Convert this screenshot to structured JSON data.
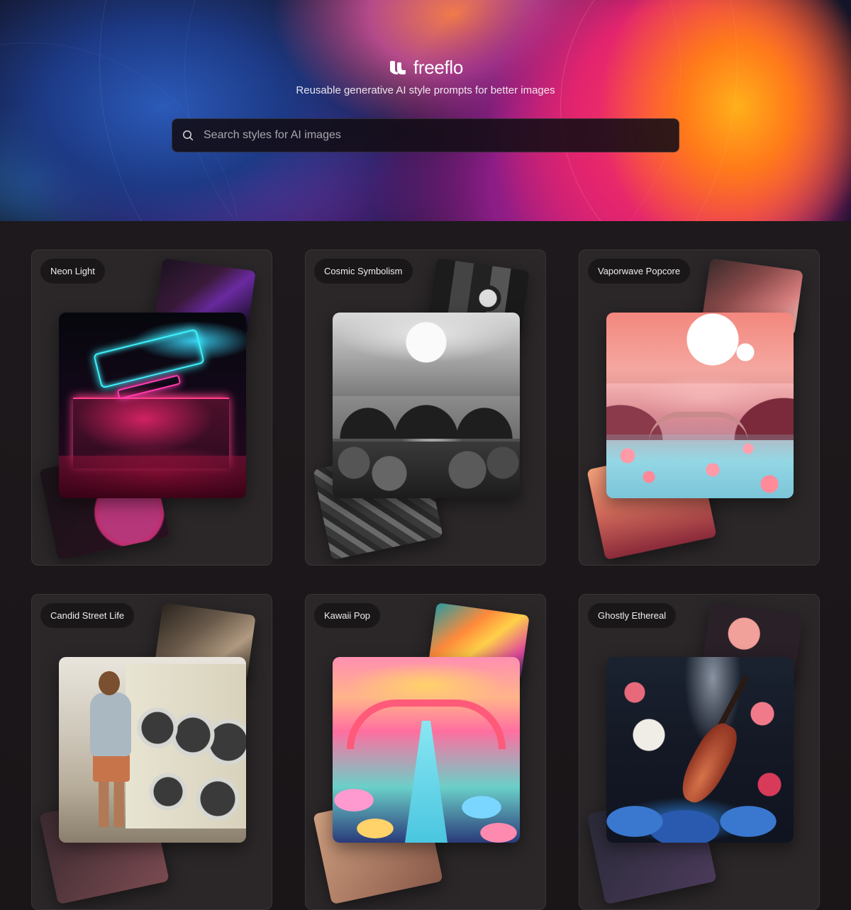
{
  "brand": {
    "name": "freeflo",
    "tagline": "Reusable generative AI style prompts for better images"
  },
  "search": {
    "placeholder": "Search styles for AI images",
    "value": "",
    "icon": "search-icon"
  },
  "cards": [
    {
      "label": "Neon Light"
    },
    {
      "label": "Cosmic Symbolism"
    },
    {
      "label": "Vaporwave Popcore"
    },
    {
      "label": "Candid Street Life"
    },
    {
      "label": "Kawaii Pop"
    },
    {
      "label": "Ghostly Ethereal"
    }
  ],
  "colors": {
    "page_background": "#1a1618",
    "card_background": "#2b2729",
    "chip_background": "#1a1719"
  }
}
